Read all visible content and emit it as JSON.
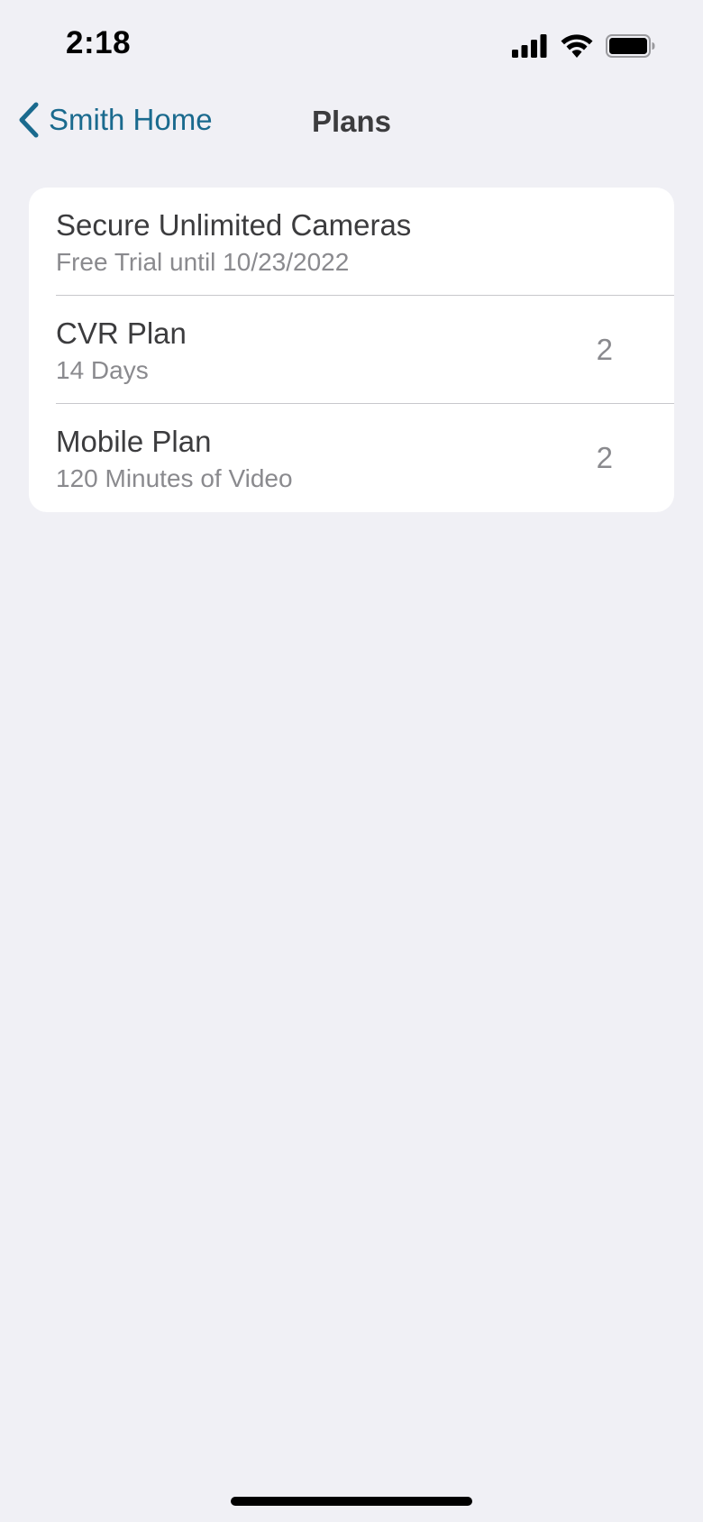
{
  "status_bar": {
    "time": "2:18",
    "icons": [
      "cellular-signal-icon",
      "wifi-icon",
      "battery-icon"
    ]
  },
  "nav": {
    "back_label": "Smith Home",
    "title": "Plans",
    "accent_color": "#1a6a8e"
  },
  "plans": [
    {
      "name": "Secure Unlimited Cameras",
      "detail": "Free Trial until 10/23/2022",
      "count": ""
    },
    {
      "name": "CVR Plan",
      "detail": "14 Days",
      "count": "2"
    },
    {
      "name": "Mobile Plan",
      "detail": "120 Minutes of Video",
      "count": "2"
    }
  ]
}
